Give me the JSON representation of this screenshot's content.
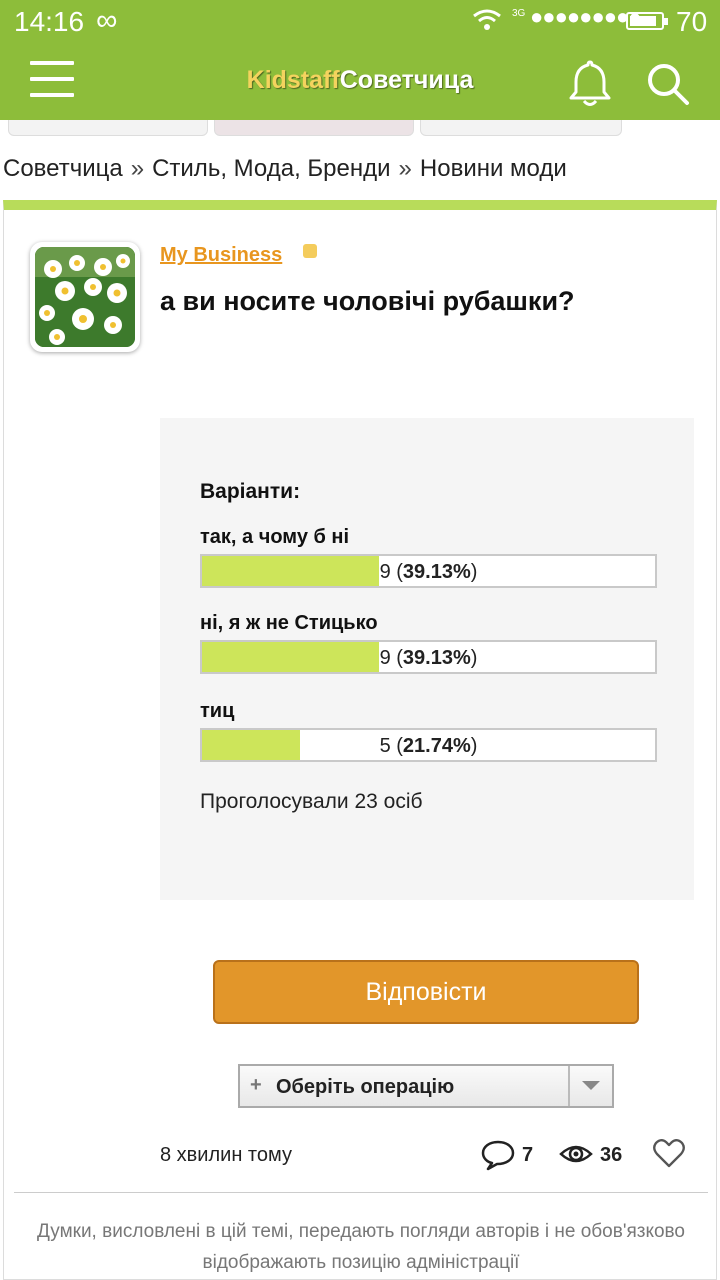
{
  "status_bar": {
    "time": "14:16",
    "network": "3G",
    "battery": "70"
  },
  "header": {
    "brand_part1": "Kidstaff",
    "brand_part2": "Советчица",
    "accent_color": "#8dbd3a"
  },
  "breadcrumb": [
    "Советчица",
    "Стиль, Мода, Бренди",
    "Новини моди"
  ],
  "breadcrumb_separator": "»",
  "post": {
    "author": "My Business",
    "title": "а ви носите чоловічі рубашки?",
    "poll": {
      "heading": "Варіанти:",
      "options": [
        {
          "label": "так, а чому б ні",
          "votes": "9",
          "percent": "39.13%",
          "fraction": 0.3913
        },
        {
          "label": "ні, я ж не Стицько",
          "votes": "9",
          "percent": "39.13%",
          "fraction": 0.3913
        },
        {
          "label": "тиц",
          "votes": "5",
          "percent": "21.74%",
          "fraction": 0.2174
        }
      ],
      "total": "Проголосували 23 осіб"
    },
    "reply_button": "Відповісти",
    "operation": {
      "plus": "+",
      "label": "Оберіть операцію"
    },
    "time_ago": "8 хвилин тому",
    "comments_count": "7",
    "views_count": "36"
  },
  "disclaimer": "Думки, висловлені в цій темі, передають погляди авторів і не обов'язково відображають позицію адміністрації",
  "icons": [
    "menu-icon",
    "bell-icon",
    "search-icon",
    "comment-icon",
    "eye-icon",
    "heart-icon",
    "chevron-down-icon"
  ]
}
